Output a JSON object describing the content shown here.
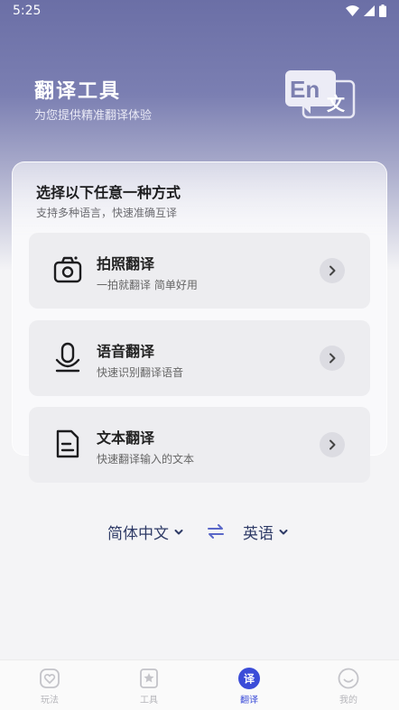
{
  "status": {
    "time": "5:25"
  },
  "header": {
    "title": "翻译工具",
    "subtitle": "为您提供精准翻译体验",
    "logo_text_en": "En",
    "logo_text_zh": "文"
  },
  "card": {
    "title": "选择以下任意一种方式",
    "subtitle": "支持多种语言，快速准确互译",
    "options": [
      {
        "title": "拍照翻译",
        "desc": "一拍就翻译 简单好用",
        "icon": "camera-icon"
      },
      {
        "title": "语音翻译",
        "desc": "快速识别翻译语音",
        "icon": "microphone-icon"
      },
      {
        "title": "文本翻译",
        "desc": "快速翻译输入的文本",
        "icon": "document-icon"
      }
    ]
  },
  "languages": {
    "source": "简体中文",
    "target": "英语"
  },
  "tabbar": {
    "tabs": [
      {
        "label": "玩法",
        "icon": "heart-icon",
        "active": false
      },
      {
        "label": "工具",
        "icon": "star-icon",
        "active": false
      },
      {
        "label": "翻译",
        "icon": "translate-icon",
        "badge": "译",
        "active": true
      },
      {
        "label": "我的",
        "icon": "smile-icon",
        "active": false
      }
    ]
  },
  "colors": {
    "accent": "#3b4cd8",
    "hero": "#6b6fa6",
    "lang_text": "#2e3a66"
  }
}
